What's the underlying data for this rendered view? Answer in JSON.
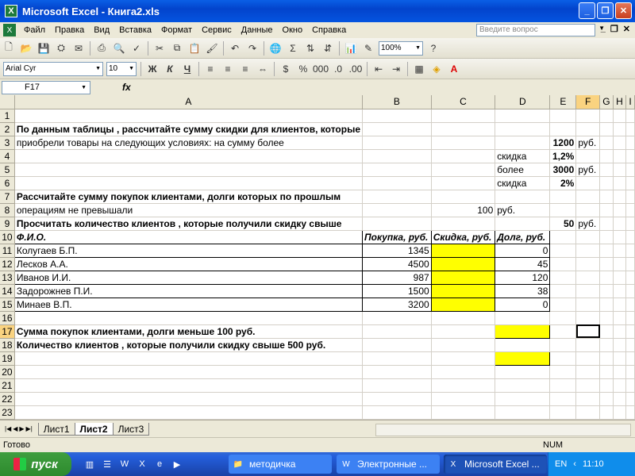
{
  "window": {
    "title": "Microsoft Excel - Книга2.xls"
  },
  "menu": [
    "Файл",
    "Правка",
    "Вид",
    "Вставка",
    "Формат",
    "Сервис",
    "Данные",
    "Окно",
    "Справка"
  ],
  "help_placeholder": "Введите вопрос",
  "toolbar": {
    "zoom": "100%",
    "font": "Arial Cyr",
    "font_size": "10"
  },
  "formula_bar": {
    "name_box": "F17",
    "fx": "fx",
    "content": ""
  },
  "columns": [
    "A",
    "B",
    "C",
    "D",
    "E",
    "F",
    "G",
    "H",
    "I"
  ],
  "rows": [
    {
      "n": "1",
      "cells": []
    },
    {
      "n": "2",
      "cells": [
        {
          "col": "A",
          "text": "По данным таблицы , рассчитайте сумму скидки для клиентов, которые",
          "style": "b"
        }
      ]
    },
    {
      "n": "3",
      "cells": [
        {
          "col": "A",
          "text": "приобрели товары на следующих условиях: на сумму более"
        },
        {
          "col": "E",
          "text": "1200",
          "style": "b r"
        },
        {
          "col": "F",
          "text": "руб."
        }
      ]
    },
    {
      "n": "4",
      "cells": [
        {
          "col": "D",
          "text": "скидка"
        },
        {
          "col": "E",
          "text": "1,2%",
          "style": "b r"
        }
      ]
    },
    {
      "n": "5",
      "cells": [
        {
          "col": "D",
          "text": "более"
        },
        {
          "col": "E",
          "text": "3000",
          "style": "b r"
        },
        {
          "col": "F",
          "text": "руб."
        }
      ]
    },
    {
      "n": "6",
      "cells": [
        {
          "col": "D",
          "text": "скидка"
        },
        {
          "col": "E",
          "text": "2%",
          "style": "b r"
        }
      ]
    },
    {
      "n": "7",
      "cells": [
        {
          "col": "A",
          "text": "Рассчитайте сумму покупок клиентами, долги которых по прошлым",
          "style": "b"
        }
      ]
    },
    {
      "n": "8",
      "cells": [
        {
          "col": "A",
          "text": "операциям не превышали"
        },
        {
          "col": "C",
          "text": "100",
          "style": "r"
        },
        {
          "col": "D",
          "text": "руб."
        }
      ]
    },
    {
      "n": "9",
      "cells": [
        {
          "col": "A",
          "text": "Просчитать количество клиентов , которые получили скидку свыше",
          "style": "b"
        },
        {
          "col": "E",
          "text": "50",
          "style": "b r"
        },
        {
          "col": "F",
          "text": "руб."
        }
      ]
    },
    {
      "n": "10",
      "cells": [
        {
          "col": "A",
          "text": "Ф.И.О.",
          "style": "bi box"
        },
        {
          "col": "B",
          "text": "Покупка, руб.",
          "style": "bi box"
        },
        {
          "col": "C",
          "text": "Скидка, руб.",
          "style": "bi box"
        },
        {
          "col": "D",
          "text": "Долг, руб.",
          "style": "bi box"
        }
      ]
    },
    {
      "n": "11",
      "cells": [
        {
          "col": "A",
          "text": "Колугаев Б.П.",
          "style": "box"
        },
        {
          "col": "B",
          "text": "1345",
          "style": "r box"
        },
        {
          "col": "C",
          "text": "",
          "style": "y box"
        },
        {
          "col": "D",
          "text": "0",
          "style": "r box"
        }
      ]
    },
    {
      "n": "12",
      "cells": [
        {
          "col": "A",
          "text": "Лесков А.А.",
          "style": "box"
        },
        {
          "col": "B",
          "text": "4500",
          "style": "r box"
        },
        {
          "col": "C",
          "text": "",
          "style": "y box"
        },
        {
          "col": "D",
          "text": "45",
          "style": "r box"
        }
      ]
    },
    {
      "n": "13",
      "cells": [
        {
          "col": "A",
          "text": "Иванов И.И.",
          "style": "box"
        },
        {
          "col": "B",
          "text": "987",
          "style": "r box"
        },
        {
          "col": "C",
          "text": "",
          "style": "y box"
        },
        {
          "col": "D",
          "text": "120",
          "style": "r box"
        }
      ]
    },
    {
      "n": "14",
      "cells": [
        {
          "col": "A",
          "text": "Задорожнев П.И.",
          "style": "box"
        },
        {
          "col": "B",
          "text": "1500",
          "style": "r box"
        },
        {
          "col": "C",
          "text": "",
          "style": "y box"
        },
        {
          "col": "D",
          "text": "38",
          "style": "r box"
        }
      ]
    },
    {
      "n": "15",
      "cells": [
        {
          "col": "A",
          "text": "Минаев В.П.",
          "style": "box"
        },
        {
          "col": "B",
          "text": "3200",
          "style": "r box"
        },
        {
          "col": "C",
          "text": "",
          "style": "y box"
        },
        {
          "col": "D",
          "text": "0",
          "style": "r box"
        }
      ]
    },
    {
      "n": "16",
      "cells": []
    },
    {
      "n": "17",
      "cells": [
        {
          "col": "A",
          "text": "Сумма покупок клиентами, долги меньше 100 руб.",
          "style": "b"
        },
        {
          "col": "D",
          "text": "",
          "style": "y box"
        },
        {
          "col": "F",
          "text": "",
          "style": "selected"
        }
      ]
    },
    {
      "n": "18",
      "cells": [
        {
          "col": "A",
          "text": "Количество клиентов , которые получили скидку свыше 500 руб.",
          "style": "b"
        }
      ]
    },
    {
      "n": "19",
      "cells": [
        {
          "col": "D",
          "text": "",
          "style": "y box"
        }
      ]
    },
    {
      "n": "20",
      "cells": []
    },
    {
      "n": "21",
      "cells": []
    },
    {
      "n": "22",
      "cells": []
    },
    {
      "n": "23",
      "cells": []
    }
  ],
  "sheet_tabs": [
    {
      "label": "Лист1",
      "active": false
    },
    {
      "label": "Лист2",
      "active": true
    },
    {
      "label": "Лист3",
      "active": false
    }
  ],
  "status": {
    "text": "Готово",
    "num": "NUM"
  },
  "taskbar": {
    "start": "пуск",
    "tasks": [
      {
        "label": "методичка",
        "active": false
      },
      {
        "label": "Электронные ...",
        "active": false
      },
      {
        "label": "Microsoft Excel ...",
        "active": true
      }
    ],
    "lang": "EN",
    "clock": "11:10"
  }
}
